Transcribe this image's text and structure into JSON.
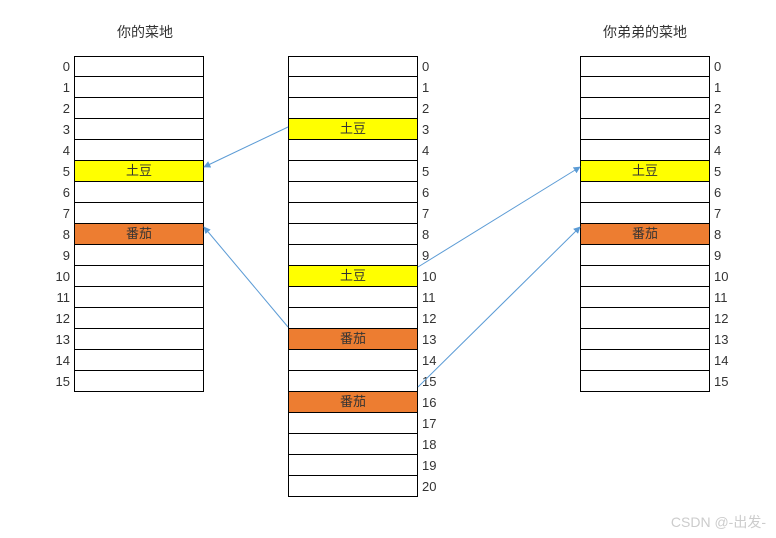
{
  "titles": {
    "left": "你的菜地",
    "right": "你弟弟的菜地"
  },
  "tables": {
    "left": {
      "rows": 16,
      "items": {
        "5": {
          "label": "土豆",
          "color": "yellow"
        },
        "8": {
          "label": "番茄",
          "color": "orange"
        }
      }
    },
    "middle": {
      "rows": 21,
      "items": {
        "3": {
          "label": "土豆",
          "color": "yellow"
        },
        "10": {
          "label": "土豆",
          "color": "yellow"
        },
        "13": {
          "label": "番茄",
          "color": "orange"
        },
        "16": {
          "label": "番茄",
          "color": "orange"
        }
      }
    },
    "right": {
      "rows": 16,
      "items": {
        "5": {
          "label": "土豆",
          "color": "yellow"
        },
        "8": {
          "label": "番茄",
          "color": "orange"
        }
      }
    }
  },
  "arrows": [
    {
      "from": "middle:3",
      "to": "left:5"
    },
    {
      "from": "middle:13",
      "to": "left:8"
    },
    {
      "from": "middle:10",
      "to": "right:5"
    },
    {
      "from": "middle:16",
      "to": "right:8"
    }
  ],
  "colors": {
    "yellow": "#ffff00",
    "orange": "#ed7d31",
    "arrow": "#5b9bd5"
  },
  "watermark": "CSDN @-出发-"
}
